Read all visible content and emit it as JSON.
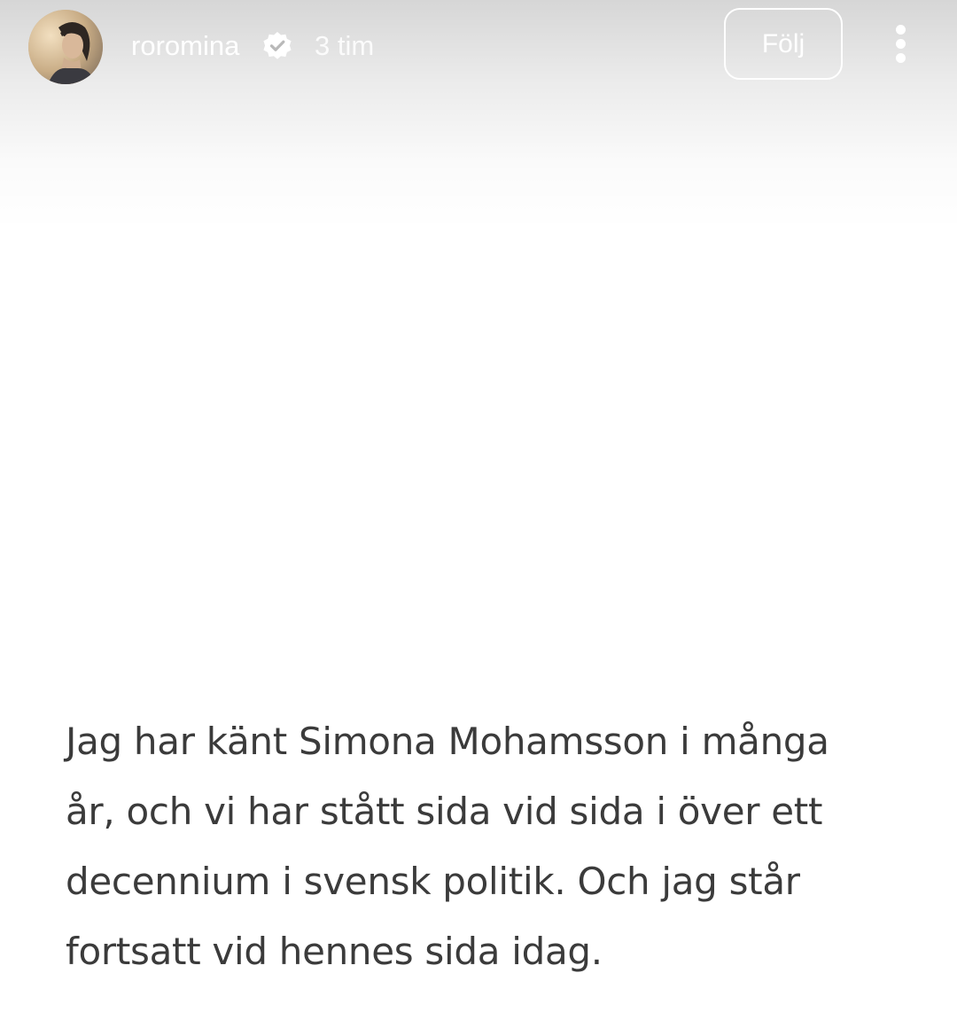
{
  "story": {
    "user": {
      "username": "roromina",
      "verified": true,
      "avatar_icon": "profile-photo"
    },
    "time_ago": "3 tim",
    "follow_label": "Följ",
    "more_icon": "vertical-dots-icon",
    "text_lines": [
      "Jag har känt Simona Mohamsson i många",
      "år, och vi har stått sida vid sida i över ett",
      "decennium i svensk politik. Och jag står",
      "fortsatt vid hennes sida idag."
    ]
  },
  "colors": {
    "overlay_text": "#ffffff",
    "body_text": "#3b3b3b",
    "background": "#ffffff"
  }
}
